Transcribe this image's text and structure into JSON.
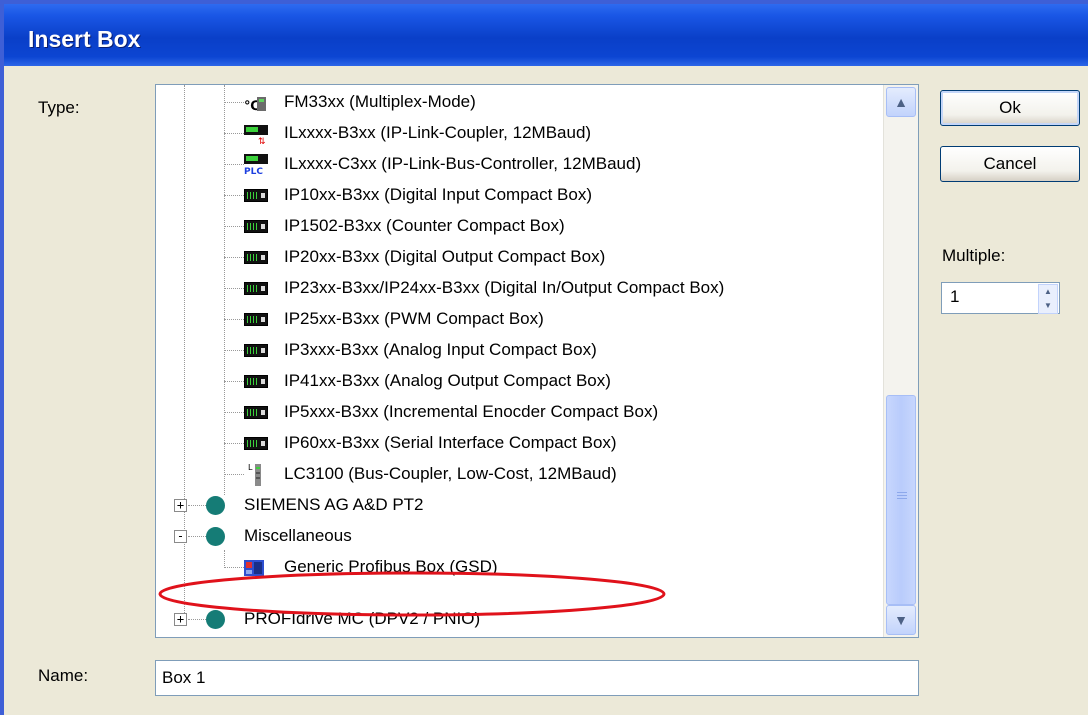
{
  "window": {
    "title": "Insert Box"
  },
  "labels": {
    "type": "Type:",
    "multiple": "Multiple:",
    "name": "Name:"
  },
  "buttons": {
    "ok": "Ok",
    "cancel": "Cancel"
  },
  "tree": {
    "items": [
      {
        "label": "FM33xx (Multiplex-Mode)",
        "icon": "fm-module-icon"
      },
      {
        "label": "ILxxxx-B3xx (IP-Link-Coupler, 12MBaud)",
        "icon": "coupler-icon"
      },
      {
        "label": "ILxxxx-C3xx (IP-Link-Bus-Controller, 12MBaud)",
        "icon": "plc-controller-icon"
      },
      {
        "label": "IP10xx-B3xx (Digital Input Compact Box)",
        "icon": "compact-box-icon"
      },
      {
        "label": "IP1502-B3xx (Counter Compact Box)",
        "icon": "compact-box-icon"
      },
      {
        "label": "IP20xx-B3xx (Digital Output Compact Box)",
        "icon": "compact-box-icon"
      },
      {
        "label": "IP23xx-B3xx/IP24xx-B3xx (Digital In/Output Compact Box)",
        "icon": "compact-box-icon"
      },
      {
        "label": "IP25xx-B3xx (PWM Compact Box)",
        "icon": "compact-box-icon"
      },
      {
        "label": "IP3xxx-B3xx (Analog Input Compact Box)",
        "icon": "compact-box-icon"
      },
      {
        "label": "IP41xx-B3xx (Analog Output Compact Box)",
        "icon": "compact-box-icon"
      },
      {
        "label": "IP5xxx-B3xx (Incremental Enocder Compact Box)",
        "icon": "compact-box-icon"
      },
      {
        "label": "IP60xx-B3xx (Serial Interface Compact Box)",
        "icon": "compact-box-icon"
      },
      {
        "label": "LC3100 (Bus-Coupler, Low-Cost, 12MBaud)",
        "icon": "bus-coupler-icon"
      },
      {
        "label": "SIEMENS AG A&D PT2",
        "icon": "vendor-icon",
        "expander": "+"
      },
      {
        "label": "Miscellaneous",
        "icon": "vendor-icon",
        "expander": "-"
      },
      {
        "label": "Generic Profibus Box (GSD)",
        "icon": "profibus-box-icon"
      },
      {
        "label": "PROFIdrive MC (DPV2 / PNIO)",
        "icon": "vendor-icon",
        "expander": "+"
      }
    ]
  },
  "multiple": {
    "value": "1"
  },
  "name": {
    "value": "Box 1"
  },
  "annotation": {
    "color": "#E0121B"
  }
}
